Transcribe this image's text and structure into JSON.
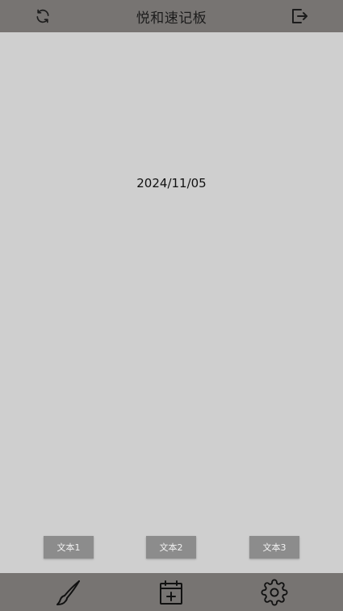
{
  "header": {
    "title": "悦和速记板",
    "left_icon": "refresh-icon",
    "right_icon": "logout-icon"
  },
  "main": {
    "date": "2024/11/05"
  },
  "text_buttons": [
    {
      "label": "文本1"
    },
    {
      "label": "文本2"
    },
    {
      "label": "文本3"
    }
  ],
  "bottom_nav": [
    {
      "icon": "brush-icon"
    },
    {
      "icon": "calendar-add-icon"
    },
    {
      "icon": "gear-icon"
    }
  ],
  "colors": {
    "bar": "#777472",
    "background": "#cfcfcf",
    "button": "#8c8c8c"
  }
}
